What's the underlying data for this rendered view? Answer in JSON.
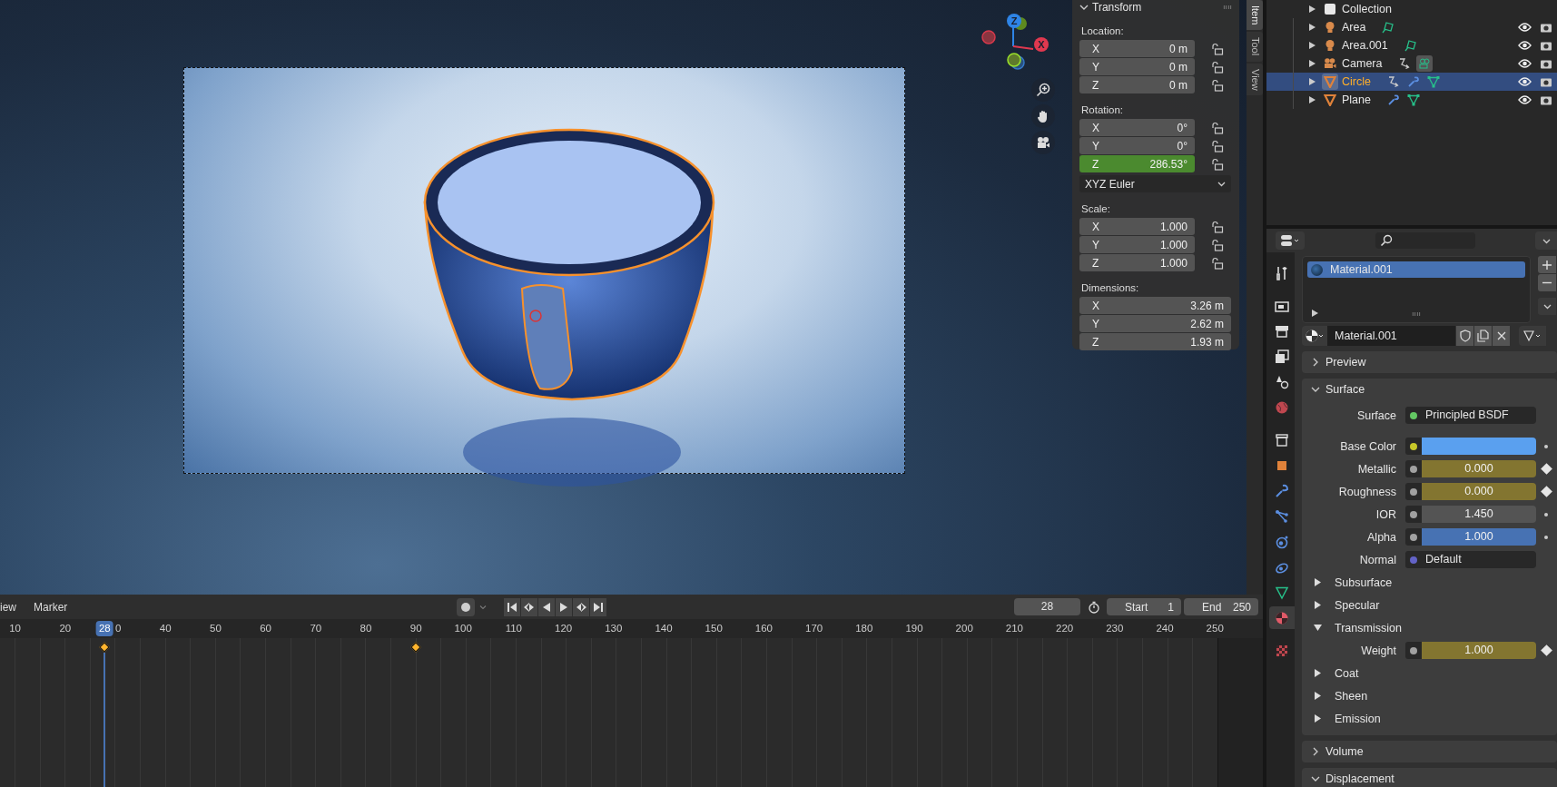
{
  "viewport": {
    "gizmo": {
      "axes": [
        {
          "label": "Z",
          "color": "#2e84e6"
        },
        {
          "label": "X",
          "color": "#e0384f"
        }
      ]
    },
    "sidebar": {
      "tabs": [
        {
          "label": "Item",
          "selected": true
        },
        {
          "label": "Tool",
          "selected": false
        },
        {
          "label": "View",
          "selected": false
        }
      ],
      "panel": {
        "title": "Transform",
        "expanded": true,
        "groups": [
          {
            "label": "Location:",
            "fields": [
              {
                "axis": "X",
                "value": "0 m",
                "animated": false,
                "locked": false
              },
              {
                "axis": "Y",
                "value": "0 m",
                "animated": false,
                "locked": false
              },
              {
                "axis": "Z",
                "value": "0 m",
                "animated": false,
                "locked": false
              }
            ]
          },
          {
            "label": "Rotation:",
            "fields": [
              {
                "axis": "X",
                "value": "0°",
                "animated": false,
                "locked": false
              },
              {
                "axis": "Y",
                "value": "0°",
                "animated": false,
                "locked": false
              },
              {
                "axis": "Z",
                "value": "286.53°",
                "animated": true,
                "locked": false
              }
            ],
            "mode": "XYZ Euler"
          },
          {
            "label": "Scale:",
            "fields": [
              {
                "axis": "X",
                "value": "1.000",
                "animated": false,
                "locked": false
              },
              {
                "axis": "Y",
                "value": "1.000",
                "animated": false,
                "locked": false
              },
              {
                "axis": "Z",
                "value": "1.000",
                "animated": false,
                "locked": false
              }
            ]
          },
          {
            "label": "Dimensions:",
            "fields": [
              {
                "axis": "X",
                "value": "3.26 m",
                "animated": false
              },
              {
                "axis": "Y",
                "value": "2.62 m",
                "animated": false
              },
              {
                "axis": "Z",
                "value": "1.93 m",
                "animated": false
              }
            ]
          }
        ]
      }
    }
  },
  "timeline": {
    "menus": [
      "iew",
      "Marker"
    ],
    "auto_keying": false,
    "current_frame": "28",
    "start": {
      "label": "Start",
      "value": "1"
    },
    "end": {
      "label": "End",
      "value": "250"
    },
    "ruler": {
      "ticks": [
        {
          "label": "10",
          "keyframe": false
        },
        {
          "label": "20",
          "keyframe": false
        },
        {
          "label": "0",
          "keyframe": false
        },
        {
          "label": "40",
          "keyframe": false
        },
        {
          "label": "50",
          "keyframe": false
        },
        {
          "label": "60",
          "keyframe": false
        },
        {
          "label": "70",
          "keyframe": false
        },
        {
          "label": "80",
          "keyframe": false
        },
        {
          "label": "90",
          "keyframe": true
        },
        {
          "label": "100",
          "keyframe": false
        },
        {
          "label": "110",
          "keyframe": false
        },
        {
          "label": "120",
          "keyframe": false
        },
        {
          "label": "130",
          "keyframe": false
        },
        {
          "label": "140",
          "keyframe": false
        },
        {
          "label": "150",
          "keyframe": false
        },
        {
          "label": "160",
          "keyframe": false
        },
        {
          "label": "170",
          "keyframe": false
        },
        {
          "label": "180",
          "keyframe": false
        },
        {
          "label": "190",
          "keyframe": false
        },
        {
          "label": "200",
          "keyframe": false
        },
        {
          "label": "210",
          "keyframe": false
        },
        {
          "label": "220",
          "keyframe": false
        },
        {
          "label": "230",
          "keyframe": false
        },
        {
          "label": "240",
          "keyframe": false
        },
        {
          "label": "250",
          "keyframe": false
        }
      ],
      "playhead": {
        "label": "28",
        "keyframe": true
      }
    }
  },
  "outliner": {
    "rows": [
      {
        "name": "Collection",
        "kind": "collection",
        "selected": false,
        "extras": []
      },
      {
        "name": "Area",
        "kind": "light",
        "selected": false,
        "extras": [
          {
            "kind": "light_data",
            "highlighted": false
          }
        ]
      },
      {
        "name": "Area.001",
        "kind": "light",
        "selected": false,
        "extras": [
          {
            "kind": "light_data",
            "highlighted": false
          }
        ]
      },
      {
        "name": "Camera",
        "kind": "camera",
        "selected": false,
        "extras": [
          {
            "kind": "constraint",
            "highlighted": false
          },
          {
            "kind": "camera_data",
            "highlighted": true
          }
        ]
      },
      {
        "name": "Circle",
        "kind": "mesh",
        "selected": true,
        "extras": [
          {
            "kind": "constraint",
            "highlighted": false
          },
          {
            "kind": "modifier",
            "highlighted": false
          },
          {
            "kind": "mesh_data",
            "highlighted": false
          }
        ]
      },
      {
        "name": "Plane",
        "kind": "mesh",
        "selected": false,
        "extras": [
          {
            "kind": "modifier",
            "highlighted": false
          },
          {
            "kind": "mesh_data",
            "highlighted": false
          }
        ]
      }
    ]
  },
  "properties": {
    "tabs": [
      {
        "kind": "tool",
        "selected": false
      },
      {
        "kind": "render",
        "selected": false
      },
      {
        "kind": "output",
        "selected": false
      },
      {
        "kind": "view_layer",
        "selected": false
      },
      {
        "kind": "scene",
        "selected": false
      },
      {
        "kind": "world",
        "selected": false
      },
      {
        "kind": "collection",
        "selected": false
      },
      {
        "kind": "object",
        "selected": false
      },
      {
        "kind": "modifier",
        "selected": false
      },
      {
        "kind": "particles",
        "selected": false
      },
      {
        "kind": "physics",
        "selected": false
      },
      {
        "kind": "constraints",
        "selected": false
      },
      {
        "kind": "data",
        "selected": false
      },
      {
        "kind": "material",
        "selected": true
      },
      {
        "kind": "texture",
        "selected": false
      }
    ],
    "slots": [
      {
        "name": "Material.001",
        "selected": true
      }
    ],
    "material": "Material.001",
    "panels": [
      {
        "title": "Preview",
        "expanded": false
      },
      {
        "title": "Surface",
        "expanded": true,
        "rows": [
          {
            "kind": "link",
            "label": "Surface",
            "value": "Principled BSDF",
            "socket": {
              "color": "#63c763"
            }
          },
          {
            "kind": "color",
            "label": "Base Color",
            "color": "#5aa0ef",
            "socket": {
              "color": "#c7c729"
            },
            "keyframed": false
          },
          {
            "kind": "number",
            "label": "Metallic",
            "value": "0.000",
            "socket": {
              "color": "#a1a1a1"
            },
            "keyframed": true
          },
          {
            "kind": "number",
            "label": "Roughness",
            "value": "0.000",
            "socket": {
              "color": "#a1a1a1"
            },
            "keyframed": true
          },
          {
            "kind": "number",
            "label": "IOR",
            "value": "1.450",
            "socket": {
              "color": "#a1a1a1"
            },
            "keyframed": false
          },
          {
            "kind": "slider",
            "label": "Alpha",
            "value": "1.000",
            "socket": {
              "color": "#a1a1a1"
            },
            "keyframed": false,
            "level": 1
          },
          {
            "kind": "link",
            "label": "Normal",
            "value": "Default",
            "socket": {
              "color": "#6363c7"
            }
          },
          {
            "kind": "sub",
            "label": "Subsurface",
            "expanded": false
          },
          {
            "kind": "sub",
            "label": "Specular",
            "expanded": false
          },
          {
            "kind": "sub",
            "label": "Transmission",
            "expanded": true
          },
          {
            "kind": "number",
            "label": "Weight",
            "value": "1.000",
            "socket": {
              "color": "#a1a1a1"
            },
            "keyframed": true
          },
          {
            "kind": "sub",
            "label": "Coat",
            "expanded": false
          },
          {
            "kind": "sub",
            "label": "Sheen",
            "expanded": false
          },
          {
            "kind": "sub",
            "label": "Emission",
            "expanded": false
          }
        ]
      },
      {
        "title": "Volume",
        "expanded": false
      },
      {
        "title": "Displacement",
        "expanded": true
      }
    ]
  }
}
